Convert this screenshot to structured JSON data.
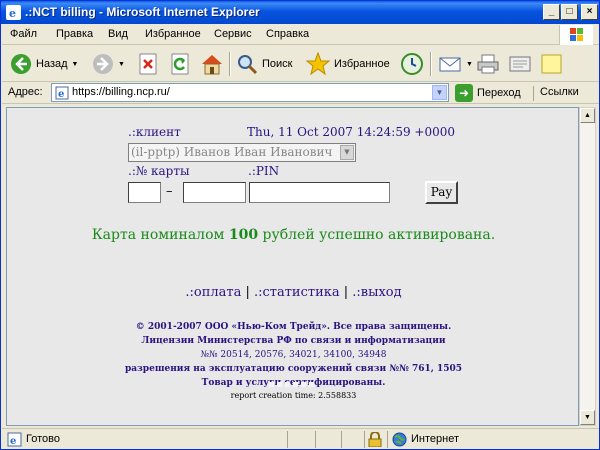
{
  "window": {
    "title": ".:NCT billing - Microsoft Internet Explorer",
    "controls": {
      "minimize": "_",
      "maximize": "□",
      "close": "×"
    }
  },
  "menu": [
    {
      "label": "Файл"
    },
    {
      "label": "Правка"
    },
    {
      "label": "Вид"
    },
    {
      "label": "Избранное"
    },
    {
      "label": "Сервис"
    },
    {
      "label": "Справка"
    }
  ],
  "toolbar": {
    "back_label": "Назад",
    "search_label": "Поиск",
    "favorites_label": "Избранное"
  },
  "address": {
    "label": "Адрес:",
    "url": "https://billing.ncp.ru/",
    "go_label": "Переход",
    "links_label": "Ссылки"
  },
  "page": {
    "client_label": ".:клиент",
    "datetime": "Thu, 11 Oct 2007 14:24:59 +0000",
    "client_select_value": "(il-pptp) Иванов Иван Иванович",
    "card_label": ".:№ карты",
    "pin_label": ".:PIN",
    "dash": "–",
    "card_part1": "",
    "card_part2": "",
    "pin": "",
    "pay_button": "Pay",
    "success_prefix": "Карта номиналом",
    "success_amount": "100",
    "success_suffix": "рублей успешно активирована.",
    "nav": [
      {
        "label": ".:оплата"
      },
      {
        "label": ".:статистика"
      },
      {
        "label": ".:выход"
      }
    ],
    "nav_sep": "|",
    "footer_lines": [
      "© 2001-2007 ООО «Нью-Ком Трейд». Все права защищены.",
      "Лицензии Министерства РФ по связи и информатизации",
      "№№ 20514, 20576, 34021, 34100, 34948",
      "разрешения на эксплуатацию сооружений связи №№ 761, 1505",
      "Товар и услуги сертифицированы."
    ],
    "report": "report creation time: 2.558833"
  },
  "status": {
    "text": "Готово",
    "zone": "Интернет"
  },
  "colors": {
    "title_bar": "#0754e0",
    "link_purple": "#2a1280",
    "success_green": "#1a8a1a",
    "content_bg": "#e8e8e8"
  },
  "icons": {
    "back": "back-arrow-icon",
    "forward": "forward-arrow-icon",
    "stop": "stop-icon",
    "refresh": "refresh-icon",
    "home": "home-icon",
    "search": "search-icon",
    "favorites": "star-icon",
    "history": "history-icon",
    "mail": "mail-icon",
    "print": "print-icon",
    "edit": "edit-icon",
    "discuss": "note-icon",
    "go": "go-arrow-icon",
    "lock": "lock-icon",
    "internet": "globe-icon"
  }
}
